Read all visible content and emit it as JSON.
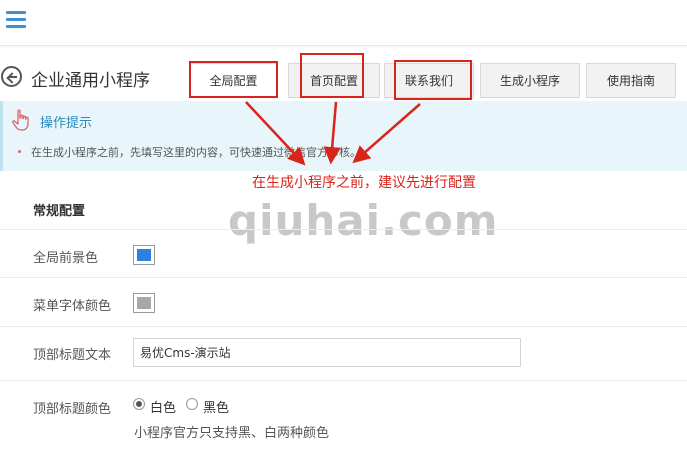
{
  "header": {
    "menu_icon": "hamburger-menu-icon"
  },
  "page": {
    "title": "企业通用小程序",
    "back_icon": "back-circle-icon"
  },
  "tabs": [
    {
      "label": "全局配置",
      "active": true
    },
    {
      "label": "首页配置",
      "active": false
    },
    {
      "label": "联系我们",
      "active": false
    },
    {
      "label": "生成小程序",
      "active": false
    },
    {
      "label": "使用指南",
      "active": false
    }
  ],
  "tips": {
    "icon": "pointing-hand-icon",
    "title": "操作提示",
    "text": "在生成小程序之前，先填写这里的内容，可快速通过微信官方审核。"
  },
  "annotation": {
    "text": "在生成小程序之前，建议先进行配置",
    "color": "#d9241b"
  },
  "watermark": "qiuhai.com",
  "section": {
    "title": "常规配置"
  },
  "form": {
    "global_fg_color": {
      "label": "全局前景色",
      "color": "#2e7fe0"
    },
    "menu_font_color": {
      "label": "菜单字体颜色",
      "color": "#a8a8a8"
    },
    "top_title_text": {
      "label": "顶部标题文本",
      "value": "易优Cms-演示站"
    },
    "top_title_color": {
      "label": "顶部标题颜色",
      "options": [
        "白色",
        "黑色"
      ],
      "selected": "白色",
      "help": "小程序官方只支持黑、白两种颜色"
    }
  }
}
